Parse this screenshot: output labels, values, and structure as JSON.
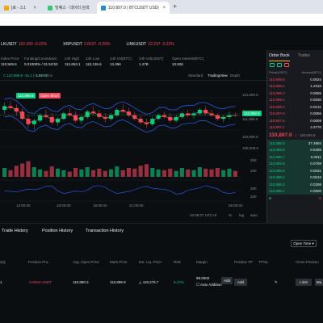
{
  "browser": {
    "tabs": [
      {
        "label": "[로 - 스1"
      },
      {
        "label": "빙퀘스 · 데이터 검색"
      },
      {
        "label": "110,897.0 | BTCUSDT USD|"
      }
    ],
    "new_tab": "+"
  },
  "ticker": [
    {
      "symbol": "LKUSDT",
      "price": "102.430",
      "change": "-0.22%",
      "dir": "down"
    },
    {
      "symbol": "XRPUSDT",
      "price": "2.8137",
      "change": "-0.26%",
      "dir": "down"
    },
    {
      "symbol": "LINKUSDT",
      "price": "22.237",
      "change": "-0.22%",
      "dir": "down"
    }
  ],
  "stats": [
    {
      "label": "Index Price",
      "value": "110,949.5"
    },
    {
      "label": "Funding/Countdown",
      "value": "0.01000% / 01:53:53"
    },
    {
      "label": "24h High",
      "value": "112,653.1"
    },
    {
      "label": "24h Low",
      "value": "110,136.6"
    },
    {
      "label": "24h Vol(BTC)",
      "value": "13.35K"
    },
    {
      "label": "24h Vol(USDT)",
      "value": "1.47B"
    },
    {
      "label": "Open Interest(BTC)",
      "value": "10.82K"
    }
  ],
  "chart_toolbar": {
    "legend": "C 110,896.9 -15.1 (-0.01%)",
    "last_price": "Last Price",
    "views": [
      "Standard",
      "TradingView",
      "Depth"
    ]
  },
  "chart": {
    "price_labels": [
      "112,000.0",
      "111,000.0",
      "110,000.0",
      "109,000.0",
      "250",
      "100",
      "200",
      "100"
    ],
    "current_price_tag": "110,896.9",
    "upper_tag": "110,896.9",
    "lower_tag": "Open Short",
    "time_labels": [
      "12:00:00",
      "15:00:00",
      "18:00:00",
      "21:00:00",
      "06:00:00"
    ],
    "footer_time": "23:06:07 UTC+9",
    "footer_opts": [
      "%",
      "log",
      "auto"
    ]
  },
  "chart_data": {
    "type": "candlestick",
    "ylim": [
      109000,
      112500
    ],
    "candles": [
      [
        111200,
        111600,
        111000,
        111400
      ],
      [
        111400,
        111700,
        111200,
        111300
      ],
      [
        111300,
        111500,
        110900,
        111100
      ],
      [
        111100,
        111300,
        110600,
        110700
      ],
      [
        110700,
        110900,
        110200,
        110400
      ],
      [
        110400,
        110700,
        110100,
        110600
      ],
      [
        110600,
        111000,
        110500,
        110900
      ],
      [
        110900,
        111200,
        110700,
        110800
      ],
      [
        110800,
        111000,
        110400,
        110500
      ],
      [
        110500,
        110800,
        110300,
        110700
      ],
      [
        110700,
        111100,
        110600,
        111000
      ],
      [
        111000,
        111300,
        110800,
        110900
      ],
      [
        110900,
        111100,
        110500,
        110600
      ],
      [
        110600,
        110900,
        110400,
        110800
      ],
      [
        110800,
        111200,
        110700,
        111100
      ],
      [
        111100,
        111400,
        110900,
        111000
      ],
      [
        111000,
        111200,
        110700,
        110800
      ],
      [
        110800,
        111000,
        110500,
        110700
      ],
      [
        110700,
        111000,
        110600,
        110900
      ],
      [
        110900,
        111300,
        110800,
        111200
      ],
      [
        111200,
        111500,
        111000,
        111100
      ],
      [
        111100,
        111300,
        110800,
        110900
      ],
      [
        110900,
        111100,
        110600,
        110700
      ],
      [
        110700,
        110900,
        110400,
        110500
      ],
      [
        110500,
        110700,
        110200,
        110400
      ],
      [
        110400,
        110800,
        110300,
        110700
      ],
      [
        110700,
        111000,
        110600,
        110900
      ],
      [
        110900,
        111100,
        110700,
        110800
      ],
      [
        110800,
        111000,
        110500,
        110600
      ],
      [
        110600,
        110900,
        110500,
        110800
      ],
      [
        110800,
        111100,
        110700,
        111000
      ],
      [
        111000,
        111200,
        110800,
        110900
      ],
      [
        110900,
        111100,
        110700,
        111000
      ],
      [
        111000,
        111300,
        110900,
        111200
      ],
      [
        111200,
        111400,
        110900,
        111000
      ],
      [
        111000,
        111200,
        110800,
        110900
      ],
      [
        110900,
        111000,
        110600,
        110700
      ],
      [
        110700,
        110900,
        110500,
        110800
      ],
      [
        110800,
        111100,
        110700,
        110900
      ],
      [
        110900,
        111050,
        110800,
        110897
      ]
    ],
    "volume": [
      120,
      90,
      150,
      180,
      210,
      130,
      100,
      80,
      140,
      110,
      90,
      70,
      120,
      100,
      130,
      90,
      110,
      80,
      100,
      140,
      90,
      120,
      110,
      150,
      170,
      120,
      100,
      90,
      110,
      80,
      120,
      100,
      90,
      130,
      110,
      100,
      120,
      90,
      110,
      80
    ]
  },
  "orderbook": {
    "tabs": [
      "Order Book",
      "Trades"
    ],
    "headers": [
      "Price(USDT)",
      "Amount(BTC)"
    ],
    "asks": [
      {
        "price": "110,898.6",
        "amount": "0.0024"
      },
      {
        "price": "110,898.4",
        "amount": "1.2310"
      },
      {
        "price": "110,898.3",
        "amount": "0.0055"
      },
      {
        "price": "110,898.2",
        "amount": "0.0030"
      },
      {
        "price": "110,898.0",
        "amount": "0.0131"
      },
      {
        "price": "110,897.9",
        "amount": "0.0055"
      },
      {
        "price": "110,897.5",
        "amount": "0.0009"
      },
      {
        "price": "110,897.1",
        "amount": "3.3770"
      }
    ],
    "mid_price": "110,897.0",
    "mid_arrow": "↓",
    "mark_price": "110,949.8",
    "bids": [
      {
        "price": "110,896.9",
        "amount": "37.4904"
      },
      {
        "price": "110,896.8",
        "amount": "0.5395"
      },
      {
        "price": "110,896.7",
        "amount": "0.0011"
      },
      {
        "price": "110,896.6",
        "amount": "0.0789"
      },
      {
        "price": "110,896.5",
        "amount": "0.0031"
      },
      {
        "price": "110,896.4",
        "amount": "0.0010"
      },
      {
        "price": "110,896.3",
        "amount": "0.0288"
      },
      {
        "price": "110,896.1",
        "amount": "0.0500"
      }
    ],
    "bottom_left": "B",
    "bottom_right": "S"
  },
  "bottom": {
    "tabs": [
      "Trade History",
      "Position History",
      "Transaction History"
    ],
    "open_time": "Open Time",
    "headers": [
      "Qty",
      "Position PnL",
      "Avg. Open Price",
      "Mark Price",
      "Est. Liq. Price",
      "Risk",
      "Margin",
      "Position TP",
      "TP/SL",
      "Close Position"
    ],
    "row": {
      "qty": "1",
      "pnl": "-0.0044 USDT",
      "avg_open": "110,880.2",
      "mark": "110,896.9",
      "liq": "118,279.7",
      "risk": "6.17%",
      "margin": "99.0002",
      "auto_add": "Auto Addition",
      "add1": "Add",
      "add2": "Add",
      "limit": "Limit",
      "market": "Ma"
    }
  }
}
